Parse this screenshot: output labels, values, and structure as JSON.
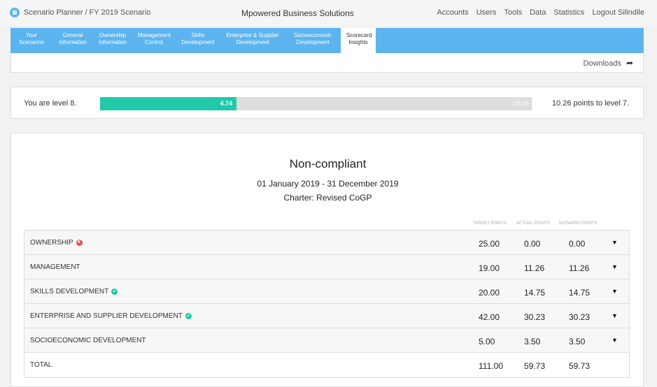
{
  "topbar": {
    "breadcrumb": "Scenario Planner / FY 2019 Scenario",
    "company": "Mpowered Business Solutions",
    "nav": [
      "Accounts",
      "Users",
      "Tools",
      "Data",
      "Statistics",
      "Logout Silindile"
    ]
  },
  "tabs": [
    {
      "l1": "Your",
      "l2": "Scenarios"
    },
    {
      "l1": "General",
      "l2": "Information"
    },
    {
      "l1": "Ownership",
      "l2": "Information"
    },
    {
      "l1": "Management",
      "l2": "Control"
    },
    {
      "l1": "Skills",
      "l2": "Development"
    },
    {
      "l1": "Enterprise & Supplier",
      "l2": "Development"
    },
    {
      "l1": "Socioeconomic",
      "l2": "Development"
    },
    {
      "l1": "Scorecard",
      "l2": "Insights"
    }
  ],
  "downloads_label": "Downloads",
  "level": {
    "text": "You are level 8.",
    "achieved": "4.74",
    "remaining": "10.26",
    "achieved_fraction": 0.316,
    "next_text": "10.26 points to level 7."
  },
  "scorecard": {
    "status": "Non-compliant",
    "period": "01 January 2019 - 31 December 2019",
    "charter": "Charter: Revised CoGP",
    "headers": {
      "target": "Target points",
      "actual": "Actual points",
      "scenario": "Scenario points"
    },
    "rows": [
      {
        "name": "OWNERSHIP",
        "status": "fail",
        "target": "25.00",
        "actual": "0.00",
        "scenario": "0.00"
      },
      {
        "name": "MANAGEMENT",
        "status": "",
        "target": "19.00",
        "actual": "11.26",
        "scenario": "11.26"
      },
      {
        "name": "SKILLS DEVELOPMENT",
        "status": "ok",
        "target": "20.00",
        "actual": "14.75",
        "scenario": "14.75"
      },
      {
        "name": "ENTERPRISE AND SUPPLIER DEVELOPMENT",
        "status": "ok",
        "target": "42.00",
        "actual": "30.23",
        "scenario": "30.23"
      },
      {
        "name": "SOCIOECONOMIC DEVELOPMENT",
        "status": "",
        "target": "5.00",
        "actual": "3.50",
        "scenario": "3.50"
      }
    ],
    "total": {
      "name": "TOTAL",
      "target": "111.00",
      "actual": "59.73",
      "scenario": "59.73"
    }
  },
  "colors": {
    "accent": "#5cb4ef",
    "progress": "#20c9a8",
    "fail": "#e5484d"
  }
}
